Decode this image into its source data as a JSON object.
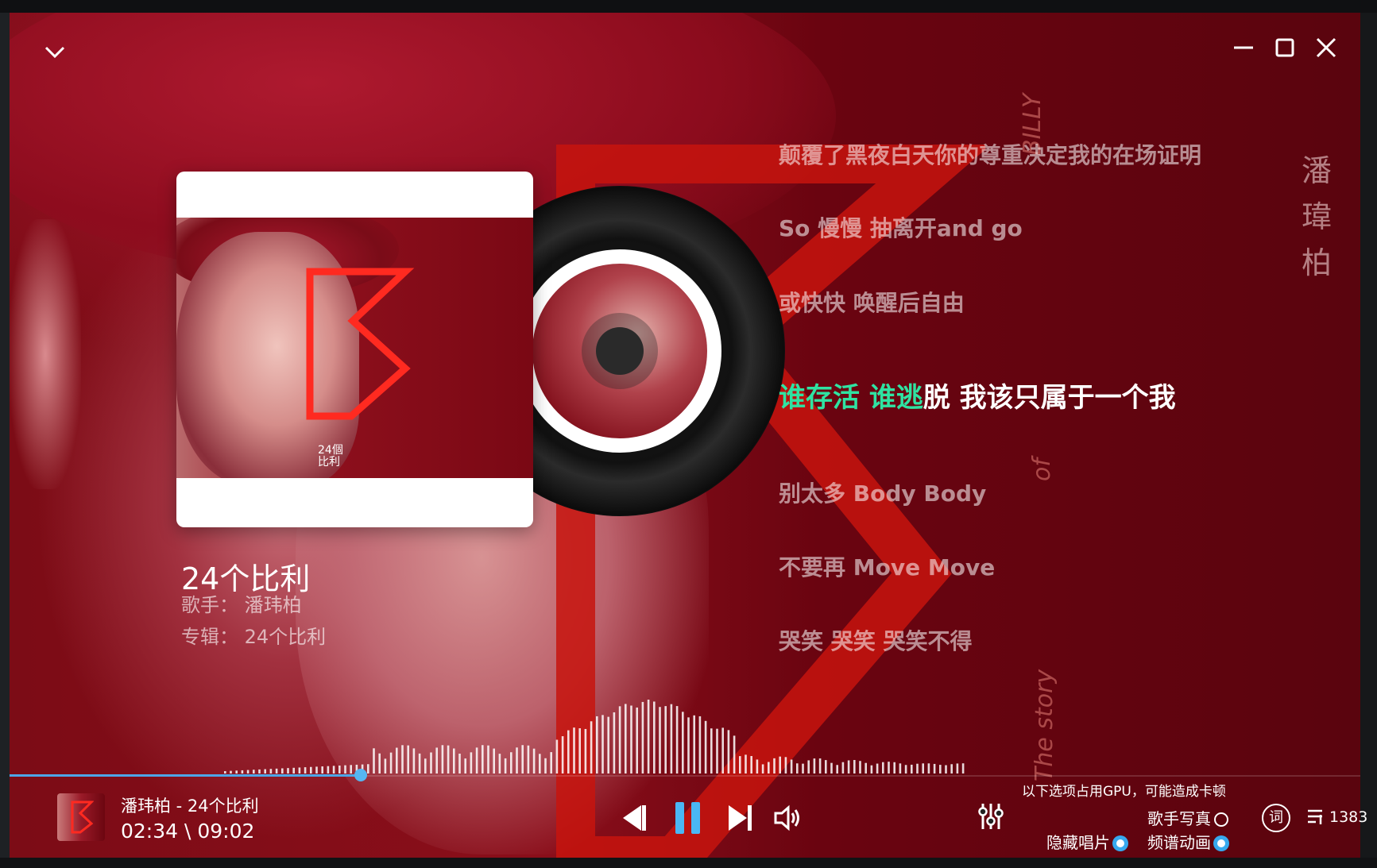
{
  "window": {
    "collapse_icon": "chevron-down-icon",
    "minimize_icon": "minimize-icon",
    "maximize_icon": "maximize-icon",
    "close_icon": "close-icon"
  },
  "background": {
    "author_vertical": "潘\n瑋\n柏",
    "vertical_texts": [
      "BILLY",
      "of",
      "The story"
    ]
  },
  "album_card": {
    "cover_title": "24個\n比利"
  },
  "song": {
    "title": "24个比利",
    "artist_label": "歌手：",
    "artist": "潘玮柏",
    "album_label": "专辑：",
    "album": "24个比利"
  },
  "lyrics": {
    "lines_before": [
      "颠覆了黑夜白天你的尊重决定我的在场证明",
      "So 慢慢 抽离开and go",
      "或快快 唤醒后自由"
    ],
    "current_sung": "谁存活 谁逃",
    "current_rest": "脱 我该只属于一个我",
    "lines_after": [
      "别太多 Body Body",
      "不要再 Move Move",
      "哭笑 哭笑 哭笑不得"
    ]
  },
  "playback": {
    "now_playing": "潘玮柏 - 24个比利",
    "time": "02:34 \\ 09:02",
    "progress": 0.26,
    "state": "playing"
  },
  "controls": {
    "prev_icon": "skip-previous-icon",
    "pause_icon": "pause-icon",
    "next_icon": "skip-next-icon",
    "volume_icon": "volume-icon",
    "equalizer_icon": "equalizer-icon",
    "lyrics_icon_label": "词",
    "playlist_icon": "playlist-icon",
    "playlist_count": "1383"
  },
  "options": {
    "gpu_note": "以下选项占用GPU，可能造成卡顿",
    "artist_photo": {
      "label": "歌手写真",
      "checked": false
    },
    "hide_disc": {
      "label": "隐藏唱片",
      "checked": true
    },
    "spectrum_anim": {
      "label": "频谱动画",
      "checked": true
    }
  },
  "colors": {
    "accent": "#37a9ee",
    "lyric_highlight": "#2fe3a2",
    "logo_red": "#e0231c"
  }
}
